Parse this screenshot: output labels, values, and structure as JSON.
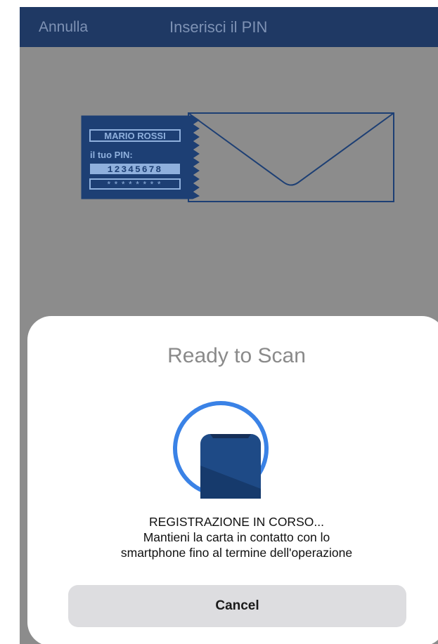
{
  "navbar": {
    "cancel_label": "Annulla",
    "title": "Inserisci il PIN"
  },
  "illustration": {
    "card_name": "MARIO ROSSI",
    "pin_label": "il tuo PIN:",
    "pin_value": "12345678",
    "masked_pin": "********",
    "icon": "envelope-icon"
  },
  "scan_sheet": {
    "title": "Ready to Scan",
    "icon": "phone-scan-icon",
    "message_lines": [
      "REGISTRAZIONE IN CORSO...",
      "Mantieni la carta in contatto con lo",
      "smartphone fino al termine dell'operazione"
    ],
    "cancel_label": "Cancel"
  },
  "colors": {
    "navbar": "#1f3964",
    "nav_text": "#7e92b4",
    "dimmed_background": "#8c8c8c",
    "illustration_blue": "#1d3f74",
    "scan_ring": "#3a82e6",
    "phone_blue": "#1e4a86",
    "cancel_button": "#dddde0"
  }
}
